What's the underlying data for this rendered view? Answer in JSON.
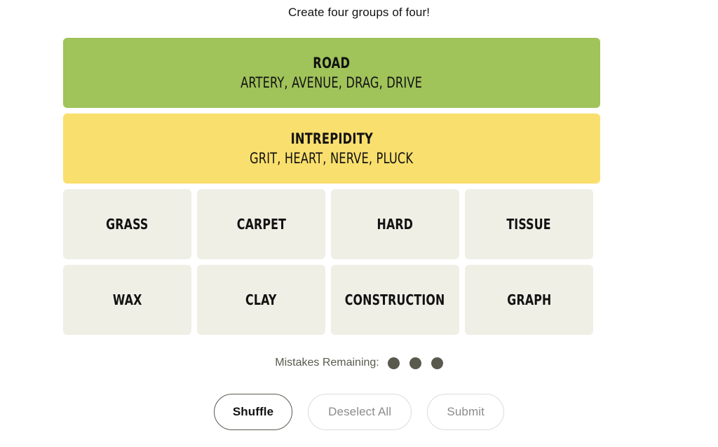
{
  "instruction": "Create four groups of four!",
  "colors": {
    "group_green": "#a0c35a",
    "group_yellow": "#f9df6d",
    "tile_bg": "#efefe6",
    "dot": "#5a594e",
    "text": "#121212",
    "disabled_text": "#8c8c8c",
    "disabled_border": "#dcdcdc",
    "page_bg": "#ffffff"
  },
  "solved_groups": [
    {
      "title": "ROAD",
      "members_text": "ARTERY, AVENUE, DRAG, DRIVE",
      "members": [
        "ARTERY",
        "AVENUE",
        "DRAG",
        "DRIVE"
      ],
      "color": "#a0c35a",
      "difficulty": "green"
    },
    {
      "title": "INTREPIDITY",
      "members_text": "GRIT, HEART, NERVE, PLUCK",
      "members": [
        "GRIT",
        "HEART",
        "NERVE",
        "PLUCK"
      ],
      "color": "#f9df6d",
      "difficulty": "yellow"
    }
  ],
  "tile_rows": [
    [
      {
        "label": "GRASS",
        "selected": false
      },
      {
        "label": "CARPET",
        "selected": false
      },
      {
        "label": "HARD",
        "selected": false
      },
      {
        "label": "TISSUE",
        "selected": false
      }
    ],
    [
      {
        "label": "WAX",
        "selected": false
      },
      {
        "label": "CLAY",
        "selected": false
      },
      {
        "label": "CONSTRUCTION",
        "selected": false
      },
      {
        "label": "GRAPH",
        "selected": false
      }
    ]
  ],
  "mistakes": {
    "label": "Mistakes Remaining:",
    "remaining": 3,
    "dots": [
      "dot-filled",
      "dot-filled",
      "dot-filled"
    ]
  },
  "controls": {
    "shuffle": {
      "label": "Shuffle",
      "enabled": true
    },
    "deselect": {
      "label": "Deselect All",
      "enabled": false
    },
    "submit": {
      "label": "Submit",
      "enabled": false
    }
  }
}
